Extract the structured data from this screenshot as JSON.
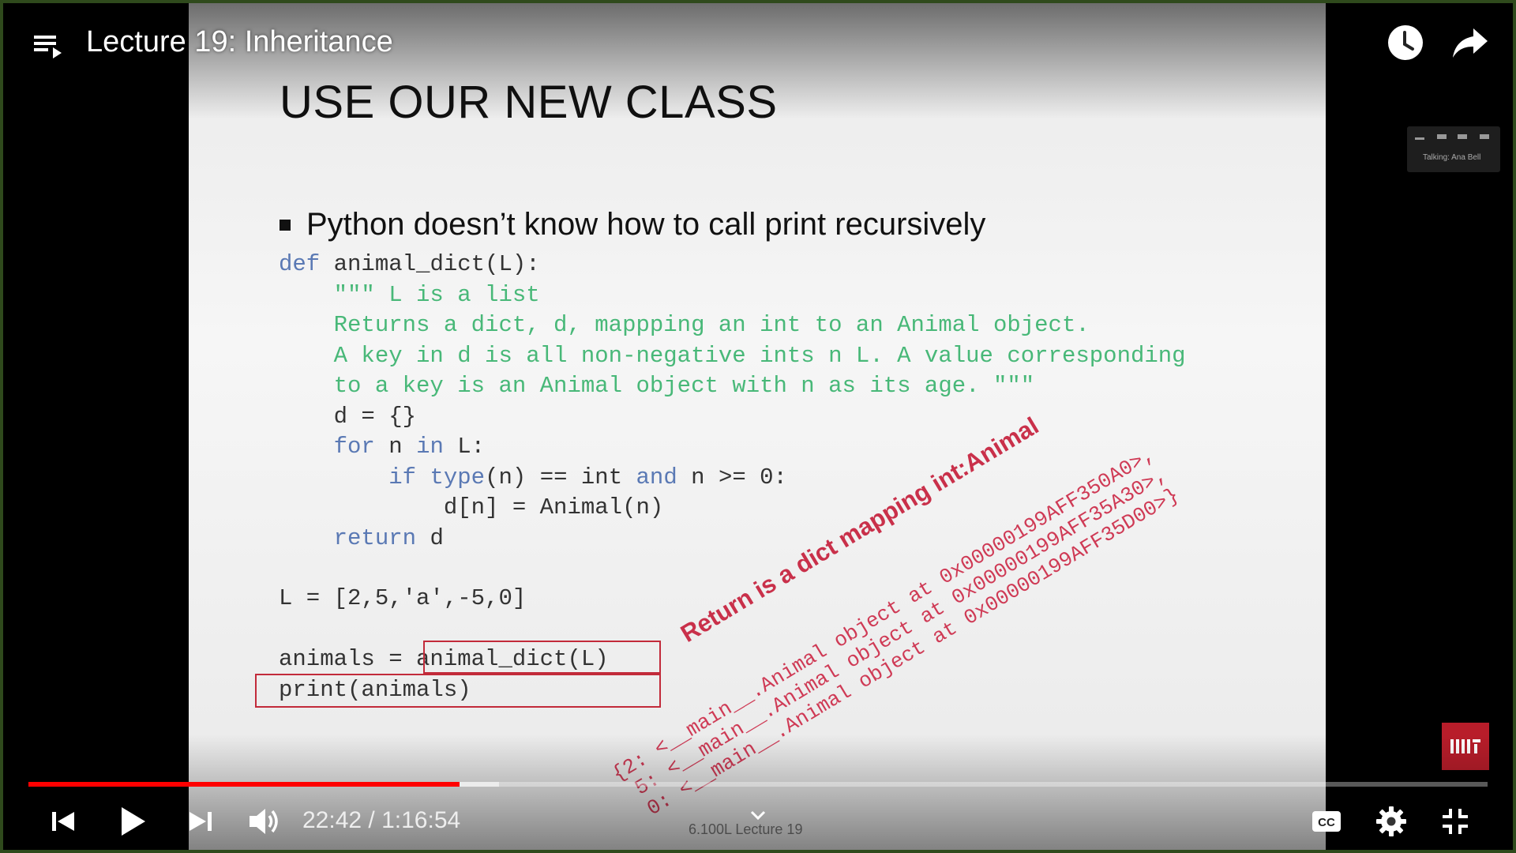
{
  "player": {
    "title": "Lecture 19: Inheritance",
    "time_current": "22:42",
    "time_separator": " / ",
    "time_total": "1:16:54",
    "progress_fraction": 0.2952,
    "buffer_fraction": 0.3225,
    "accent_color": "#ff0000",
    "icons": {
      "playlist": "playlist-icon",
      "watch_later": "clock-icon",
      "share": "share-arrow-icon",
      "prev": "skip-previous-icon",
      "play": "play-icon",
      "next": "skip-next-icon",
      "volume": "volume-icon",
      "chevron": "chevron-down-icon",
      "cc": "closed-captions-icon",
      "settings": "gear-icon",
      "fullscreen": "exit-fullscreen-icon"
    }
  },
  "meeting": {
    "label": "Talking: Ana Bell"
  },
  "slide": {
    "title": "USE OUR NEW CLASS",
    "bullet": "Python doesn’t know how to call print recursively",
    "code": {
      "l1_kw": "def",
      "l1_rest": " animal_dict(L):",
      "l2": "    \"\"\" L is a list",
      "l3": "    Returns a dict, d, mappping an int to an Animal object.",
      "l4": "    A key in d is all non-negative ints n L. A value corresponding",
      "l5": "    to a key is an Animal object with n as its age. \"\"\"",
      "l6": "    d = {}",
      "l7_indent": "    ",
      "l7_for": "for",
      "l7_n": " n ",
      "l7_in": "in",
      "l7_rest": " L:",
      "l8_indent": "        ",
      "l8_if": "if",
      "l8_sp": " ",
      "l8_type": "type",
      "l8_mid": "(n) == int ",
      "l8_and": "and",
      "l8_rest": " n >= 0:",
      "l9": "            d[n] = Animal(n)",
      "l10_indent": "    ",
      "l10_return": "return",
      "l10_rest": " d",
      "list_line": "L = [2,5,'a',-5,0]",
      "animals_line": "animals = animal_dict(L)",
      "print_line": "print(animals)"
    },
    "annotation": "Return is a dict mapping int:Animal",
    "output": [
      "{2: <__main__.Animal object at 0x00000199AFF350A0>,",
      " 5: <__main__.Animal object at 0x00000199AFF35A30>,",
      " 0: <__main__.Animal object at 0x00000199AFF35D00>}"
    ],
    "footer": "6.100L Lecture 19"
  },
  "logo": {
    "text": "MIT",
    "color": "#b81d2a"
  }
}
